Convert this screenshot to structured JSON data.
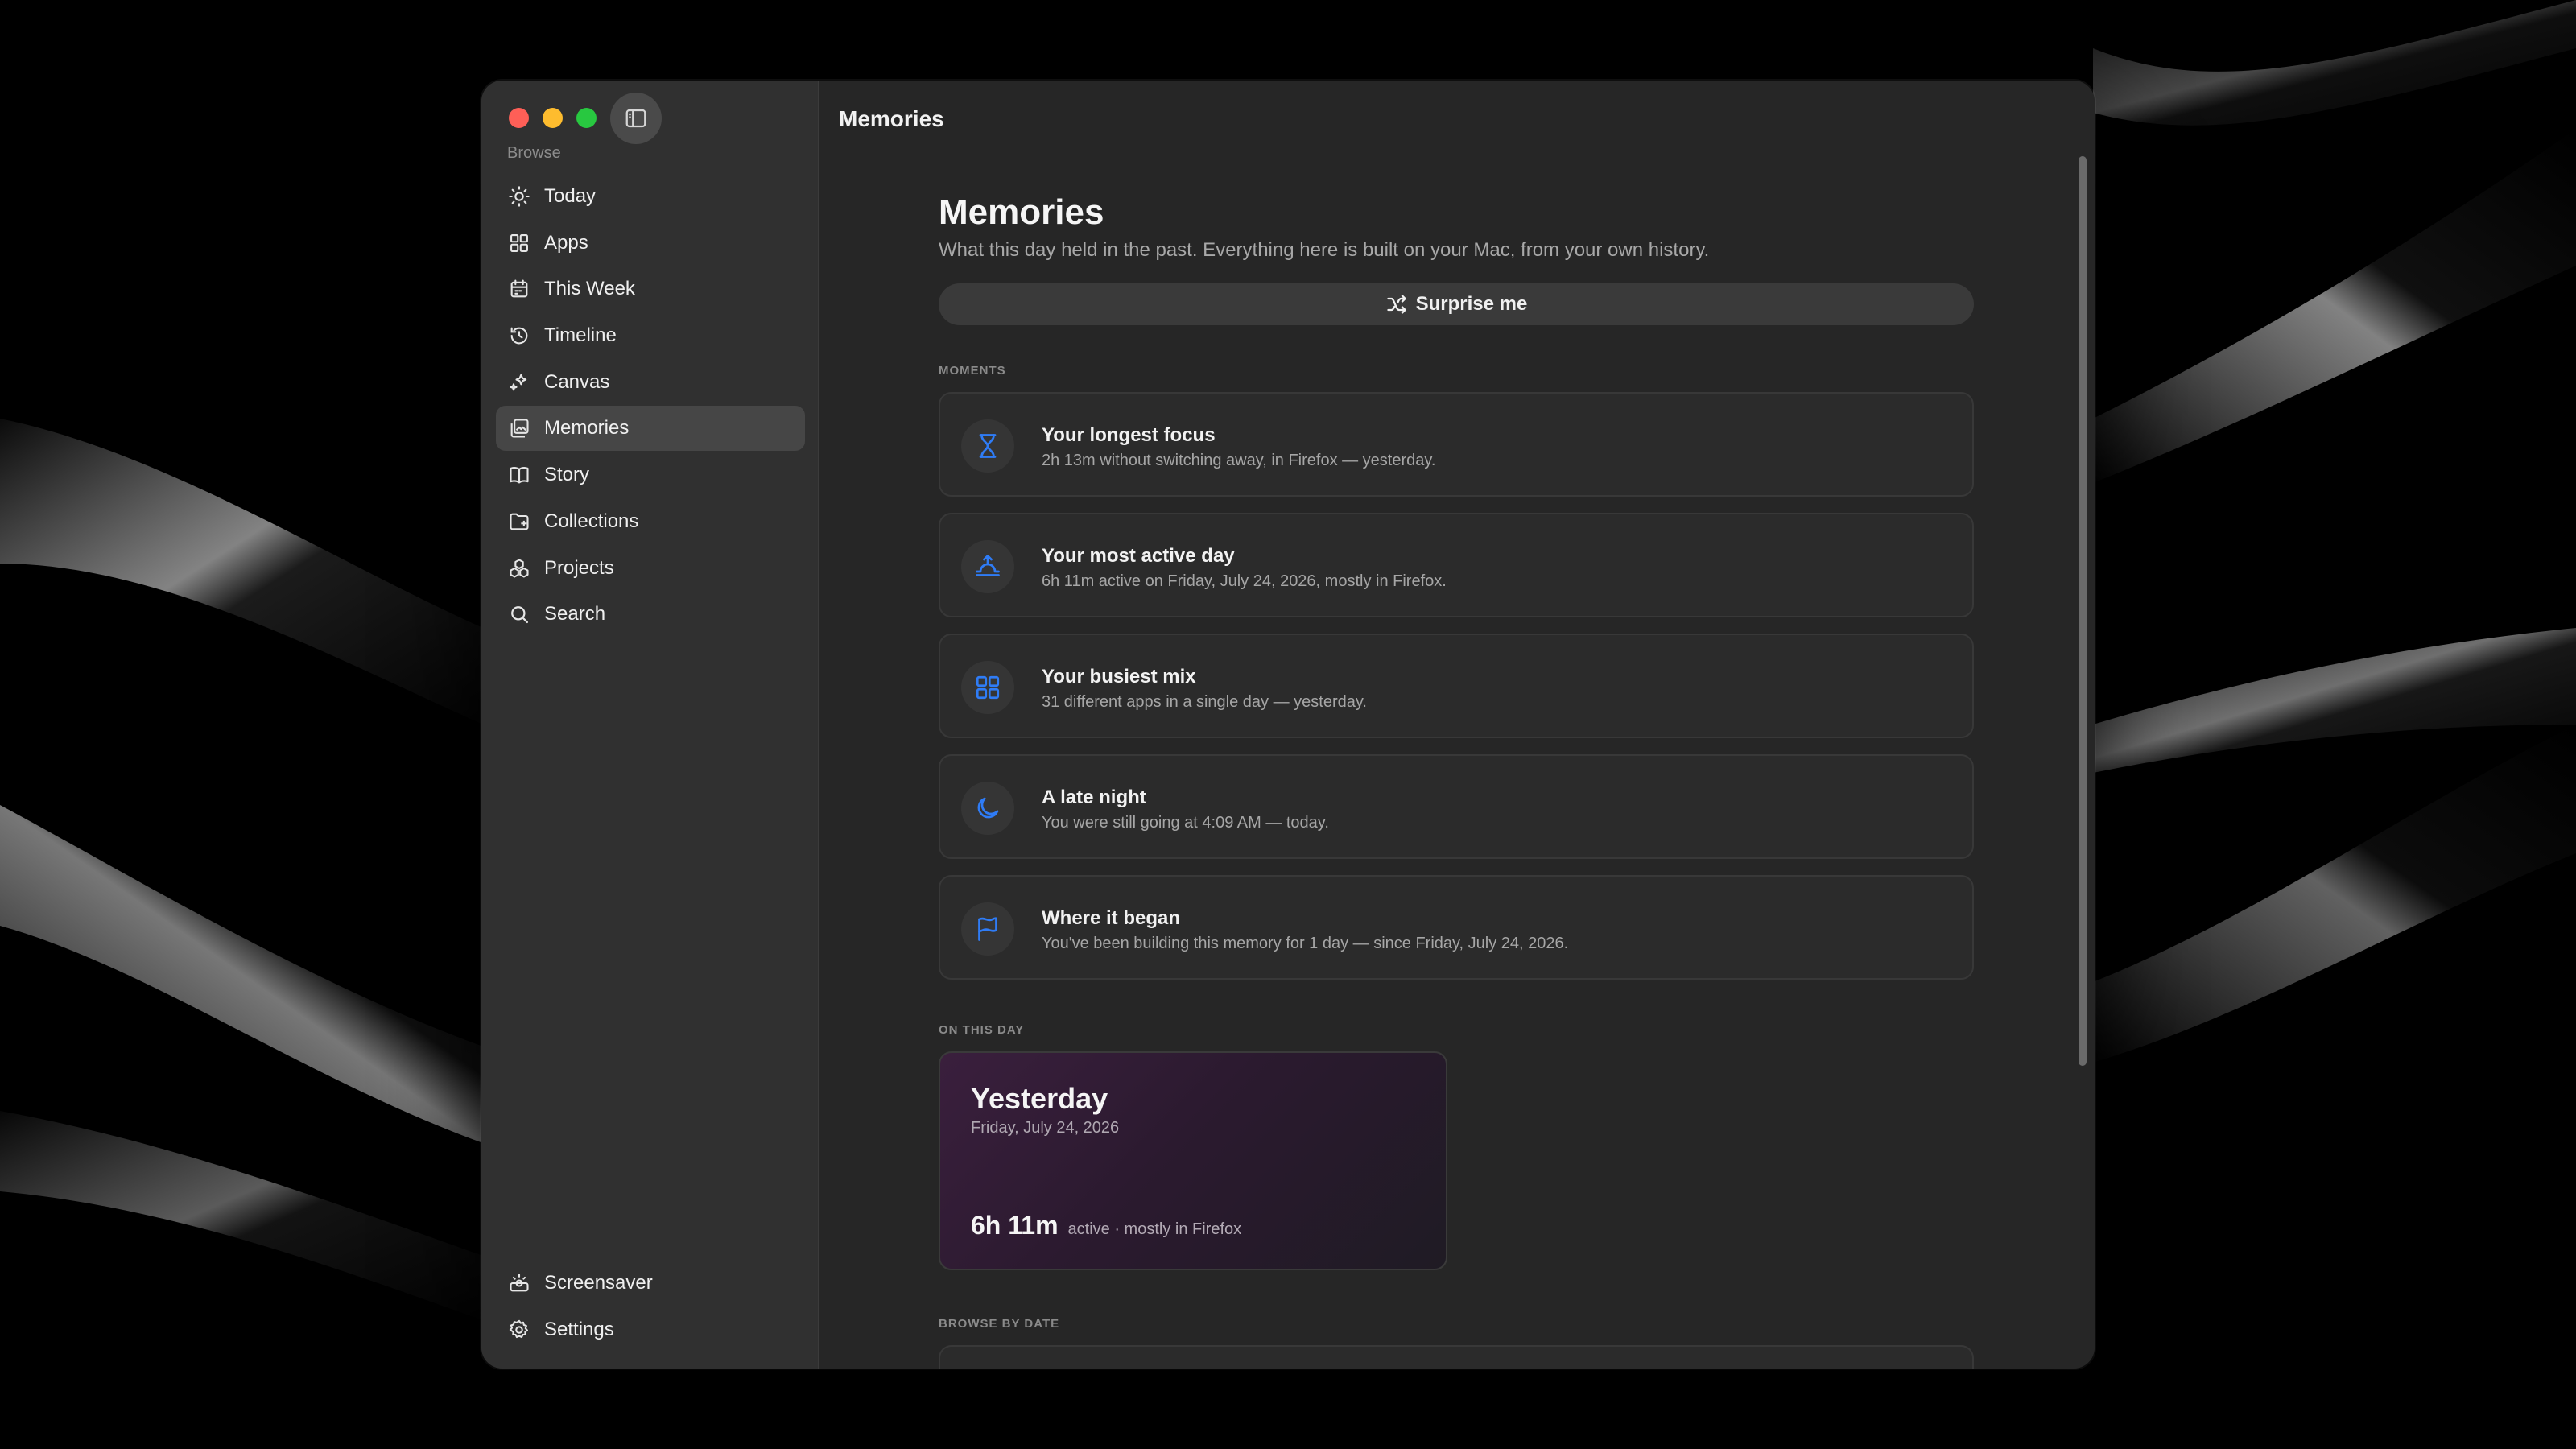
{
  "window": {
    "title": "Memories"
  },
  "sidebar": {
    "section_label": "Browse",
    "items": [
      {
        "label": "Today",
        "icon": "sun-icon",
        "active": false
      },
      {
        "label": "Apps",
        "icon": "grid-icon",
        "active": false
      },
      {
        "label": "This Week",
        "icon": "calendar-icon",
        "active": false
      },
      {
        "label": "Timeline",
        "icon": "history-icon",
        "active": false
      },
      {
        "label": "Canvas",
        "icon": "sparkles-icon",
        "active": false
      },
      {
        "label": "Memories",
        "icon": "photos-icon",
        "active": true
      },
      {
        "label": "Story",
        "icon": "book-icon",
        "active": false
      },
      {
        "label": "Collections",
        "icon": "folder-icon",
        "active": false
      },
      {
        "label": "Projects",
        "icon": "cubes-icon",
        "active": false
      },
      {
        "label": "Search",
        "icon": "search-icon",
        "active": false
      }
    ],
    "bottom_items": [
      {
        "label": "Screensaver",
        "icon": "screensaver-icon"
      },
      {
        "label": "Settings",
        "icon": "gear-icon"
      }
    ]
  },
  "main": {
    "title": "Memories",
    "subtitle": "What this day held in the past. Everything here is built on your Mac, from your own history.",
    "surprise_button": "Surprise me",
    "moments_label": "MOMENTS",
    "moments": [
      {
        "icon": "hourglass-icon",
        "title": "Your longest focus",
        "description": "2h 13m without switching away, in Firefox — yesterday."
      },
      {
        "icon": "sunrise-icon",
        "title": "Your most active day",
        "description": "6h 11m active on Friday, July 24, 2026, mostly in Firefox."
      },
      {
        "icon": "grid-icon",
        "title": "Your busiest mix",
        "description": "31 different apps in a single day — yesterday."
      },
      {
        "icon": "moon-icon",
        "title": "A late night",
        "description": "You were still going at 4:09 AM — today."
      },
      {
        "icon": "flag-icon",
        "title": "Where it began",
        "description": "You've been building this memory for 1 day — since Friday, July 24, 2026."
      }
    ],
    "on_this_day_label": "ON THIS DAY",
    "on_this_day": {
      "title": "Yesterday",
      "date": "Friday, July 24, 2026",
      "hours": "6h 11m",
      "detail": "active · mostly in Firefox"
    },
    "browse_by_date_label": "BROWSE BY DATE"
  },
  "colors": {
    "accent": "#2f7cf6",
    "traffic_red": "#fe5f57",
    "traffic_yellow": "#febc2e",
    "traffic_green": "#28c840"
  }
}
